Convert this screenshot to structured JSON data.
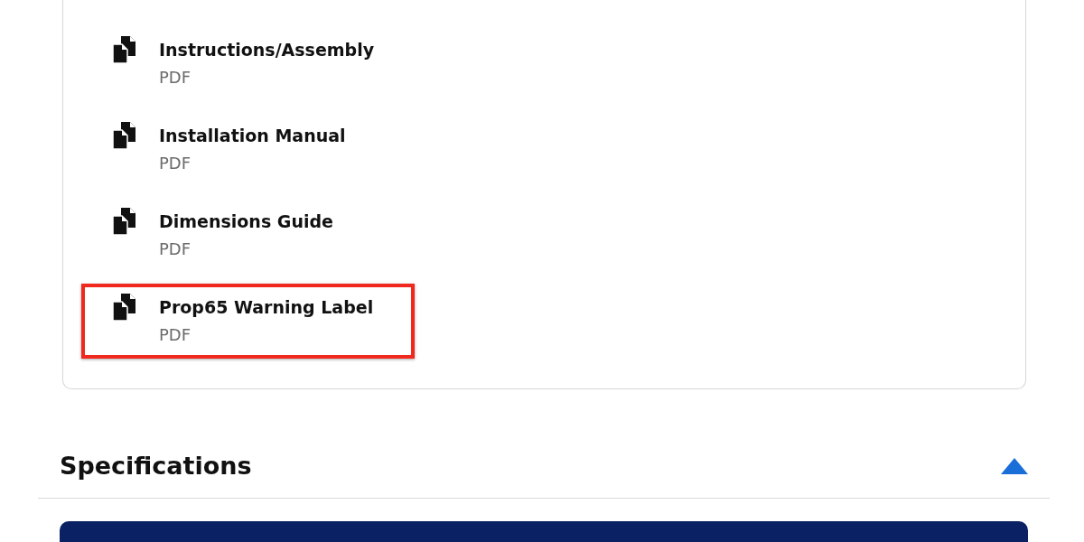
{
  "documents": [
    {
      "title": "Instructions/Assembly",
      "format": "PDF",
      "highlighted": false
    },
    {
      "title": "Installation Manual",
      "format": "PDF",
      "highlighted": false
    },
    {
      "title": "Dimensions Guide",
      "format": "PDF",
      "highlighted": false
    },
    {
      "title": "Prop65 Warning Label",
      "format": "PDF",
      "highlighted": true
    }
  ],
  "specifications": {
    "title": "Specifications",
    "expanded": true
  }
}
